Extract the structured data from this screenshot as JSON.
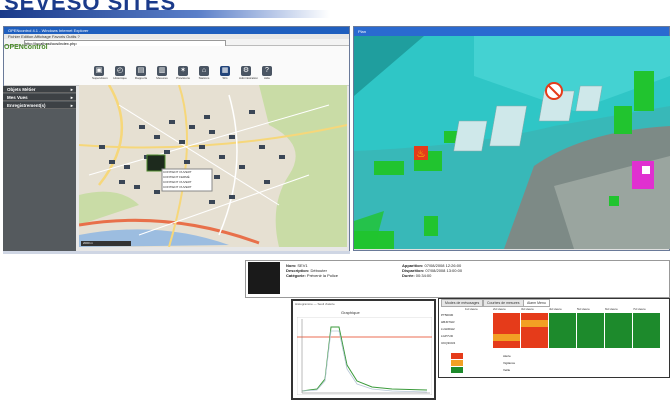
{
  "slide": {
    "title": "SEVESO SITES"
  },
  "colors": {
    "title": "#1a3a8a",
    "accent_green": "#4a8a2a",
    "water": "#2fc6c6",
    "sidebar": "#555a5e"
  },
  "window1": {
    "title": "OPENcontrol 4.1 - Windows Internet Explorer",
    "menu": "Fichier  Edition  Affichage  Favoris  Outils  ?",
    "address": "http://localhost/ocs/index.php",
    "logo": "OPENcontrol",
    "toolbar": [
      {
        "label": "Supervision",
        "icon": "monitor-icon"
      },
      {
        "label": "Historique",
        "icon": "history-icon"
      },
      {
        "label": "Rapports",
        "icon": "report-icon"
      },
      {
        "label": "Mesures",
        "icon": "chart-icon"
      },
      {
        "label": "Prévisions",
        "icon": "forecast-icon"
      },
      {
        "label": "Stations",
        "icon": "station-icon"
      },
      {
        "label": "SIG",
        "icon": "map-icon"
      },
      {
        "label": "Administration",
        "icon": "gear-icon"
      },
      {
        "label": "Aide",
        "icon": "help-icon"
      }
    ],
    "sidebar": [
      {
        "label": "Objets Métier"
      },
      {
        "label": "Mes Vues"
      },
      {
        "label": "Enregistrement(s)"
      }
    ],
    "popup": [
      "CONTIENT OUVERT",
      "CONTIENT FERMÉ",
      "CONTIENT OUVERT",
      "CONTIENT OUVERT"
    ],
    "scale": "2000 m"
  },
  "window2": {
    "title": "Plan"
  },
  "info_panel": {
    "rows_left": [
      {
        "k": "Nom:",
        "v": "SEV1"
      },
      {
        "k": "Description:",
        "v": "Débouter"
      },
      {
        "k": "Catégorie:",
        "v": "Prévenir la Police"
      }
    ],
    "rows_right": [
      {
        "k": "Apparition:",
        "v": "07/08/2008 12:26:00"
      },
      {
        "k": "Disparition:",
        "v": "07/08/2008 13:00:00"
      },
      {
        "k": "Durée:",
        "v": "00:34:00"
      }
    ]
  },
  "graph": {
    "title": "Graphique",
    "subtitle": "Histogramme — Seuil d'alerte"
  },
  "heatmap": {
    "tabs": [
      "Modes de mésusages",
      "Courbes de mesures",
      "Alarm Menu"
    ],
    "columns": [
      "1H Heure",
      "2H Heure",
      "3H Heure",
      "4H Heure",
      "5H Heure",
      "6H Heure",
      "7H Heure"
    ],
    "rows": [
      "PT50030",
      "HBJ07GR",
      "LUH3DH2",
      "LGP7UD",
      "UKQ3CR4"
    ],
    "legend": [
      {
        "label": "Alerte",
        "color": "#e53b1a"
      },
      {
        "label": "Vigilance",
        "color": "#f2a024"
      },
      {
        "label": "Veille",
        "color": "#1d8a2c"
      }
    ]
  }
}
